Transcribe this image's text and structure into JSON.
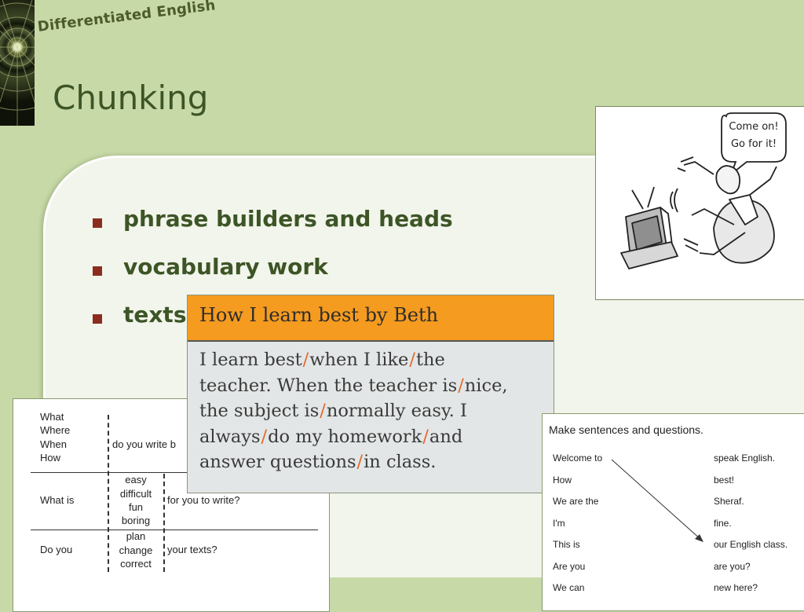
{
  "brand": "Differentiated English",
  "title": "Chunking",
  "bullets": [
    "phrase builders and heads",
    "vocabulary work",
    "texts"
  ],
  "cartoon": {
    "bubble_line1": "Come on!",
    "bubble_line2": "Go for it!"
  },
  "phrase_table": {
    "row1": {
      "col1": [
        "What",
        "Where",
        "When",
        "How"
      ],
      "col2": "do you write b"
    },
    "row2": {
      "col1": "What is",
      "col2": [
        "easy",
        "difficult",
        "fun",
        "boring"
      ],
      "col3": "for you to write?"
    },
    "row3": {
      "col1": "Do you",
      "col2": [
        "plan",
        "change",
        "correct"
      ],
      "col3": "your texts?"
    }
  },
  "sentence_box": {
    "title": "How I learn best by Beth",
    "lines": [
      [
        "I learn best",
        "when I like",
        "the"
      ],
      [
        "teacher. When the teacher is",
        "nice,"
      ],
      [
        "the subject is",
        "normally easy. I"
      ],
      [
        "always",
        "do my homework",
        "and"
      ],
      [
        "answer questions",
        "in class."
      ]
    ],
    "slash_glyph": "/",
    "slash_color": "#e2672b",
    "header_color": "#f59b1f"
  },
  "matching": {
    "heading": "Make sentences and questions.",
    "left": [
      "Welcome to",
      "How",
      "We are the",
      "I'm",
      "This is",
      "Are you",
      "We can"
    ],
    "right": [
      "speak English.",
      "best!",
      "Sheraf.",
      "fine.",
      "our English class.",
      "are you?",
      "new here?"
    ]
  },
  "colors": {
    "background": "#c8d9a8",
    "panel": "#f2f5eb",
    "title": "#3d5526",
    "bullet": "#8a2d1f"
  }
}
